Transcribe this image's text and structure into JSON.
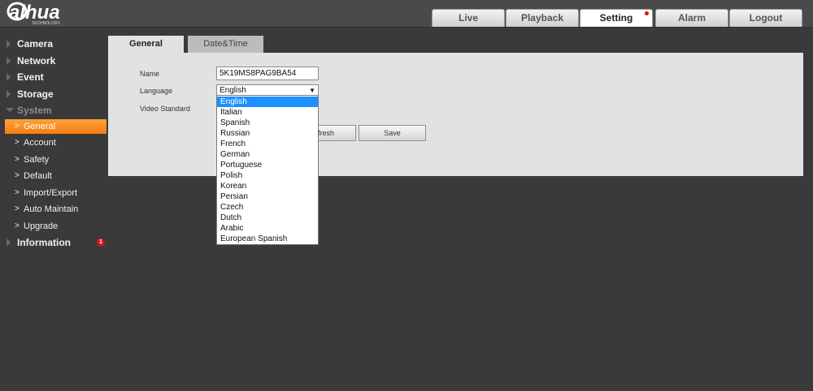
{
  "brand": {
    "logo_text": "alhua",
    "logo_sub": "TECHNOLOGY"
  },
  "nav": {
    "tabs": [
      {
        "label": "Live",
        "active": false
      },
      {
        "label": "Playback",
        "active": false
      },
      {
        "label": "Setting",
        "active": true
      },
      {
        "label": "Alarm",
        "active": false
      },
      {
        "label": "Logout",
        "active": false
      }
    ]
  },
  "sidebar": {
    "sections": [
      {
        "label": "Camera",
        "expanded": false
      },
      {
        "label": "Network",
        "expanded": false
      },
      {
        "label": "Event",
        "expanded": false
      },
      {
        "label": "Storage",
        "expanded": false
      },
      {
        "label": "System",
        "expanded": true
      }
    ],
    "system_items": [
      {
        "label": "General",
        "active": true
      },
      {
        "label": "Account",
        "active": false
      },
      {
        "label": "Safety",
        "active": false
      },
      {
        "label": "Default",
        "active": false
      },
      {
        "label": "Import/Export",
        "active": false
      },
      {
        "label": "Auto Maintain",
        "active": false
      },
      {
        "label": "Upgrade",
        "active": false
      }
    ],
    "information": {
      "label": "Information",
      "badge": "1"
    }
  },
  "content": {
    "tabs": [
      {
        "label": "General",
        "active": true
      },
      {
        "label": "Date&Time",
        "active": false
      }
    ],
    "form": {
      "name_label": "Name",
      "name_value": "5K19MS8PAG9BA54",
      "language_label": "Language",
      "language_value": "English",
      "video_standard_label": "Video Standard"
    },
    "buttons": {
      "refresh": "fresh",
      "save": "Save"
    },
    "language_options": [
      "English",
      "Italian",
      "Spanish",
      "Russian",
      "French",
      "German",
      "Portuguese",
      "Polish",
      "Korean",
      "Persian",
      "Czech",
      "Dutch",
      "Arabic",
      "European Spanish"
    ]
  },
  "colors": {
    "accent": "#f47d12",
    "selection": "#1e90ff",
    "badge": "#d8141c"
  }
}
